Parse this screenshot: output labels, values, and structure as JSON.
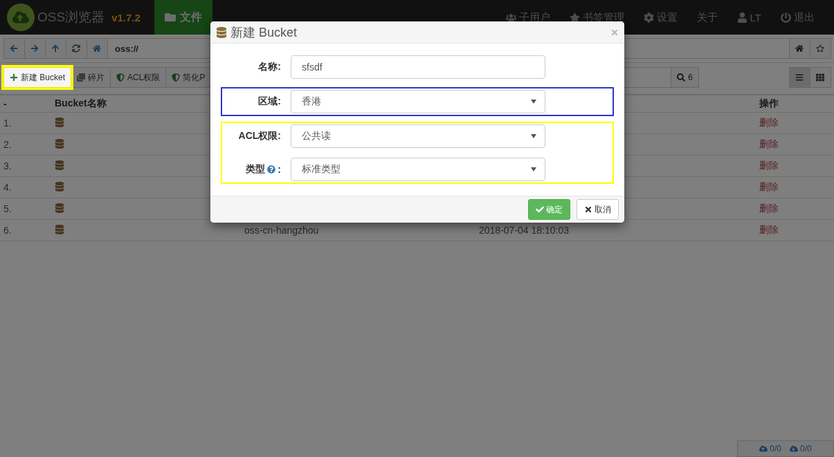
{
  "navbar": {
    "brand": "OSS浏览器",
    "version": "v1.7.2",
    "tabs": [
      {
        "label": "文件",
        "kind": "folder",
        "selected": true
      }
    ],
    "menu": [
      {
        "label": "子用户",
        "kind": "users"
      },
      {
        "label": "书签管理",
        "kind": "star"
      },
      {
        "label": "设置",
        "kind": "gear"
      },
      {
        "label": "关于",
        "kind": "none"
      },
      {
        "label": "LT",
        "kind": "user"
      },
      {
        "label": "退出",
        "kind": "power"
      }
    ]
  },
  "address_bar": {
    "value": "oss://"
  },
  "toolbar": {
    "buttons": [
      {
        "label": "新建 Bucket",
        "kind": "plus",
        "highlighted": true
      },
      {
        "label": "碎片",
        "kind": "clone",
        "highlighted": false
      },
      {
        "label": "ACL权限",
        "kind": "shield",
        "highlighted": false
      },
      {
        "label": "简化P",
        "kind": "shield",
        "highlighted": false
      }
    ],
    "search_count": "6",
    "views": [
      {
        "kind": "list",
        "selected": true
      },
      {
        "kind": "grid",
        "selected": false
      }
    ]
  },
  "table": {
    "columns": [
      "-",
      "Bucket名称",
      "操作"
    ],
    "rows": [
      {
        "index": "1.",
        "action": "删除"
      },
      {
        "index": "2.",
        "action": "删除"
      },
      {
        "index": "3.",
        "action": "删除"
      },
      {
        "index": "4.",
        "action": "删除"
      },
      {
        "index": "5.",
        "action": "删除"
      },
      {
        "index": "6.",
        "region": "oss-cn-hangzhou",
        "created": "2018-07-04 18:10:03",
        "action": "删除"
      }
    ]
  },
  "status_bar": {
    "upload": "0/0",
    "download": "0/0"
  },
  "dialog": {
    "title": "新建 Bucket",
    "groups": [
      {
        "fields": [
          {
            "label": "名称:",
            "kind": "text",
            "value": "sfsdf",
            "help": false
          }
        ]
      },
      {
        "color": "#3333cc",
        "fields": [
          {
            "label": "区域:",
            "kind": "select",
            "value": "香港",
            "help": false
          }
        ]
      },
      {
        "color": "#ffff00",
        "fields": [
          {
            "label": "ACL权限:",
            "kind": "select",
            "value": "公共读",
            "help": false
          },
          {
            "label": "类型",
            "suffix": ":",
            "kind": "select",
            "value": "标准类型",
            "help": true
          }
        ]
      }
    ],
    "confirm": "确定",
    "cancel": "取消"
  }
}
